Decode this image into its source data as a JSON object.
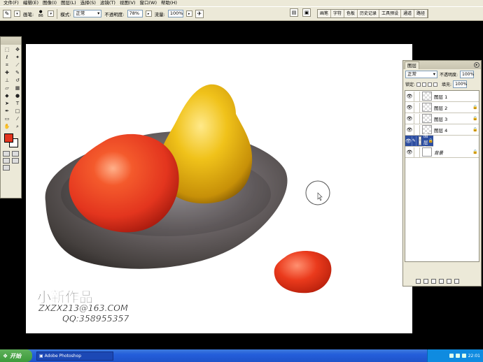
{
  "menu": [
    "文件(F)",
    "编辑(E)",
    "图像(I)",
    "图层(L)",
    "选择(S)",
    "滤镜(T)",
    "视图(V)",
    "窗口(W)",
    "帮助(H)"
  ],
  "options": {
    "brush_label": "画笔:",
    "brush_size": "86",
    "mode_label": "模式:",
    "mode_value": "正常",
    "opacity_label": "不透明度:",
    "opacity_value": "78%",
    "flow_label": "流量:",
    "flow_value": "100%"
  },
  "palette_well": [
    "画笔",
    "字符",
    "色板",
    "历史记录",
    "工具预设",
    "通道",
    "路径"
  ],
  "layers_panel": {
    "tab": "图层",
    "blend_mode": "正常",
    "opacity_label": "不透明度:",
    "opacity_value": "100%",
    "lock_label": "锁定:",
    "fill_label": "填充:",
    "fill_value": "100%",
    "layers": [
      {
        "name": "图层 1",
        "selected": false,
        "locked": false
      },
      {
        "name": "图层 2",
        "selected": false,
        "locked": true
      },
      {
        "name": "图层 3",
        "selected": false,
        "locked": true
      },
      {
        "name": "图层 4",
        "selected": false,
        "locked": true
      },
      {
        "name": "图层 5",
        "selected": true,
        "locked": true
      },
      {
        "name": "背景",
        "selected": false,
        "locked": true
      }
    ]
  },
  "watermark": {
    "title": "小新作品",
    "email": "ZXZX213@163.COM",
    "qq": "QQ:358955357"
  },
  "taskbar": {
    "start": "开始",
    "task": "Adobe Photoshop",
    "time": "22:01"
  },
  "colors": {
    "foreground": "#e3351e",
    "background": "#ffffff",
    "selected_layer": "#2d4ea0"
  }
}
